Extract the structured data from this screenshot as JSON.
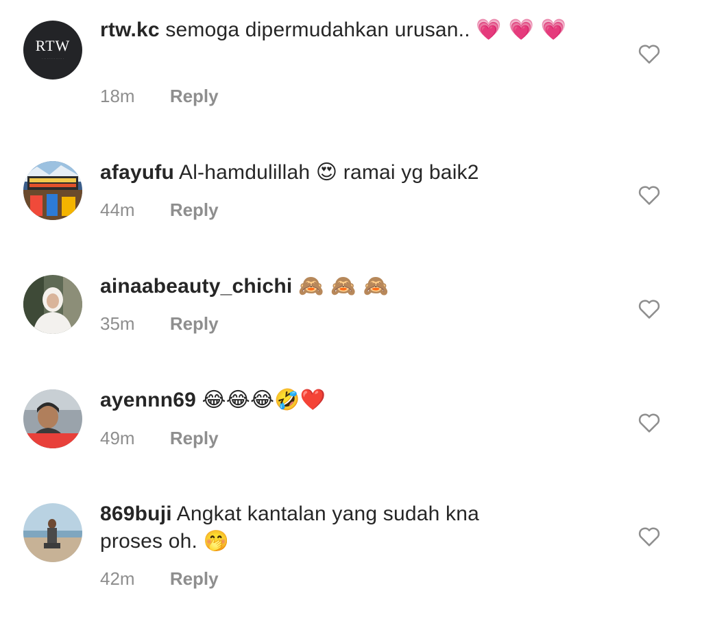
{
  "comments": [
    {
      "username": "rtw.kc",
      "text": "semoga dipermudahkan urusan..",
      "emoji": "💗 💗 💗",
      "time": "18m",
      "reply_label": "Reply",
      "avatar_label": "RTW"
    },
    {
      "username": "afayufu",
      "text": "Al-hamdulillah 😍 ramai yg baik2",
      "time": "44m",
      "reply_label": "Reply"
    },
    {
      "username": "ainaabeauty_chichi",
      "text": "🙈 🙈 🙈",
      "time": "35m",
      "reply_label": "Reply"
    },
    {
      "username": "ayennn69",
      "text": "😂😂😂🤣❤️",
      "time": "49m",
      "reply_label": "Reply"
    },
    {
      "username": "869buji",
      "text": "Angkat kantalan yang sudah kna proses oh. 🤭",
      "time": "42m",
      "reply_label": "Reply"
    }
  ],
  "colors": {
    "text": "#262626",
    "meta": "#8e8e8e",
    "heart_outline": "#8e8e8e",
    "background": "#ffffff"
  },
  "icons": {
    "like": "heart-outline-icon"
  }
}
